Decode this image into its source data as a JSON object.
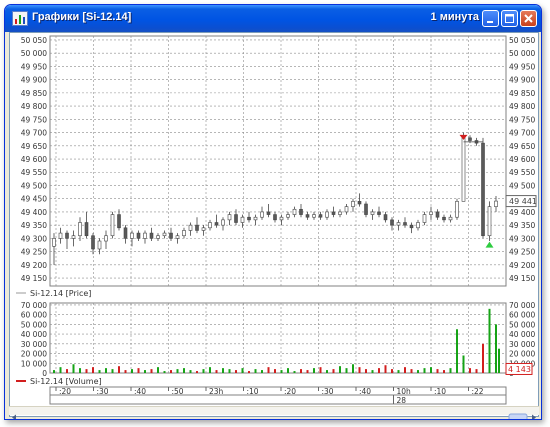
{
  "window": {
    "title": "Графики [Si-12.14]",
    "interval": "1 минута"
  },
  "price_panel": {
    "legend": "Si-12.14 [Price]",
    "y_ticks": [
      50050,
      50000,
      49950,
      49900,
      49850,
      49800,
      49750,
      49700,
      49650,
      49600,
      49550,
      49500,
      49450,
      49400,
      49350,
      49300,
      49250,
      49200,
      49150
    ],
    "y_tick_labels": [
      "50 050",
      "50 000",
      "49 950",
      "49 900",
      "49 850",
      "49 800",
      "49 750",
      "49 700",
      "49 650",
      "49 600",
      "49 550",
      "49 500",
      "49 450",
      "49 400",
      "49 350",
      "49 300",
      "49 250",
      "49 200",
      "49 150"
    ],
    "y_range": [
      49120,
      50065
    ],
    "last_price_label": "49 441",
    "last_price": 49441,
    "order_level": 49680
  },
  "volume_panel": {
    "legend": "Si-12.14 [Volume]",
    "y_ticks": [
      70000,
      60000,
      50000,
      40000,
      30000,
      20000,
      10000,
      0
    ],
    "y_tick_labels": [
      "70 000",
      "60 000",
      "50 000",
      "40 000",
      "30 000",
      "20 000",
      "10 000",
      "0"
    ],
    "y_range": [
      0,
      72000
    ],
    "last_volume_label": "4 143",
    "last_volume": 4143
  },
  "time_axis": {
    "labels": [
      ":20",
      ":30",
      ":40",
      ":50",
      "23h",
      ":10",
      ":20",
      ":30",
      ":40",
      "10h",
      ":10",
      ":22"
    ],
    "day_label": "28"
  },
  "colors": {
    "up": "#16a316",
    "down": "#d21e1e",
    "body_dark": "#5a5a5a",
    "grid": "#8c8c8c",
    "titlebar": "#0054e3"
  },
  "chart_data": {
    "type": "candlestick",
    "series": [
      {
        "name": "Si-12.14 [Price]",
        "ohlc": [
          [
            49270,
            49320,
            49200,
            49300
          ],
          [
            49300,
            49340,
            49280,
            49320
          ],
          [
            49320,
            49330,
            49260,
            49300
          ],
          [
            49300,
            49330,
            49270,
            49310
          ],
          [
            49310,
            49380,
            49290,
            49360
          ],
          [
            49360,
            49400,
            49300,
            49310
          ],
          [
            49310,
            49320,
            49240,
            49260
          ],
          [
            49260,
            49300,
            49240,
            49290
          ],
          [
            49290,
            49330,
            49260,
            49310
          ],
          [
            49310,
            49400,
            49300,
            49390
          ],
          [
            49390,
            49410,
            49330,
            49340
          ],
          [
            49340,
            49350,
            49280,
            49300
          ],
          [
            49300,
            49330,
            49270,
            49320
          ],
          [
            49320,
            49330,
            49290,
            49300
          ],
          [
            49300,
            49330,
            49280,
            49320
          ],
          [
            49320,
            49340,
            49290,
            49300
          ],
          [
            49300,
            49320,
            49290,
            49310
          ],
          [
            49310,
            49330,
            49300,
            49320
          ],
          [
            49320,
            49340,
            49290,
            49300
          ],
          [
            49300,
            49320,
            49280,
            49310
          ],
          [
            49310,
            49340,
            49300,
            49330
          ],
          [
            49330,
            49360,
            49310,
            49350
          ],
          [
            49350,
            49380,
            49320,
            49330
          ],
          [
            49330,
            49350,
            49310,
            49340
          ],
          [
            49340,
            49370,
            49330,
            49360
          ],
          [
            49360,
            49390,
            49340,
            49350
          ],
          [
            49350,
            49380,
            49330,
            49370
          ],
          [
            49370,
            49400,
            49350,
            49390
          ],
          [
            49390,
            49410,
            49350,
            49360
          ],
          [
            49360,
            49390,
            49340,
            49380
          ],
          [
            49380,
            49400,
            49360,
            49370
          ],
          [
            49370,
            49390,
            49350,
            49380
          ],
          [
            49380,
            49420,
            49370,
            49400
          ],
          [
            49400,
            49430,
            49380,
            49390
          ],
          [
            49390,
            49400,
            49360,
            49370
          ],
          [
            49370,
            49390,
            49350,
            49380
          ],
          [
            49380,
            49400,
            49370,
            49390
          ],
          [
            49390,
            49420,
            49380,
            49410
          ],
          [
            49410,
            49430,
            49380,
            49390
          ],
          [
            49390,
            49400,
            49370,
            49380
          ],
          [
            49380,
            49400,
            49370,
            49390
          ],
          [
            49390,
            49400,
            49370,
            49380
          ],
          [
            49380,
            49410,
            49370,
            49400
          ],
          [
            49400,
            49420,
            49380,
            49390
          ],
          [
            49390,
            49410,
            49380,
            49400
          ],
          [
            49400,
            49430,
            49390,
            49420
          ],
          [
            49420,
            49450,
            49400,
            49440
          ],
          [
            49440,
            49470,
            49420,
            49430
          ],
          [
            49430,
            49440,
            49380,
            49390
          ],
          [
            49390,
            49410,
            49370,
            49400
          ],
          [
            49400,
            49420,
            49380,
            49390
          ],
          [
            49390,
            49400,
            49360,
            49370
          ],
          [
            49370,
            49380,
            49330,
            49350
          ],
          [
            49350,
            49370,
            49330,
            49360
          ],
          [
            49360,
            49380,
            49340,
            49350
          ],
          [
            49350,
            49360,
            49320,
            49340
          ],
          [
            49340,
            49370,
            49330,
            49360
          ],
          [
            49360,
            49400,
            49350,
            49390
          ],
          [
            49390,
            49420,
            49370,
            49400
          ],
          [
            49400,
            49410,
            49370,
            49380
          ],
          [
            49380,
            49390,
            49360,
            49370
          ],
          [
            49370,
            49390,
            49360,
            49380
          ],
          [
            49380,
            49450,
            49370,
            49440
          ],
          [
            49440,
            49700,
            49440,
            49680
          ],
          [
            49680,
            49690,
            49660,
            49670
          ],
          [
            49670,
            49680,
            49650,
            49660
          ],
          [
            49660,
            49680,
            49300,
            49310
          ],
          [
            49310,
            49440,
            49290,
            49420
          ],
          [
            49420,
            49460,
            49400,
            49441
          ]
        ]
      },
      {
        "name": "Si-12.14 [Volume]",
        "values": [
          3000,
          6000,
          4000,
          9000,
          5000,
          4000,
          6000,
          3000,
          5000,
          4000,
          7000,
          3000,
          4000,
          5000,
          3000,
          4000,
          6000,
          2000,
          3000,
          4000,
          5000,
          3000,
          2000,
          4000,
          6000,
          3000,
          5000,
          4000,
          3000,
          5000,
          2000,
          4000,
          3000,
          6000,
          4000,
          3000,
          5000,
          2000,
          4000,
          3000,
          5000,
          6000,
          3000,
          4000,
          7000,
          5000,
          9000,
          6000,
          4000,
          3000,
          5000,
          8000,
          4000,
          3000,
          6000,
          4000,
          3000,
          5000,
          6000,
          4000,
          3000,
          5000,
          45000,
          18000,
          5000,
          4000,
          30000,
          66000,
          50000,
          25000,
          4143
        ]
      }
    ]
  }
}
